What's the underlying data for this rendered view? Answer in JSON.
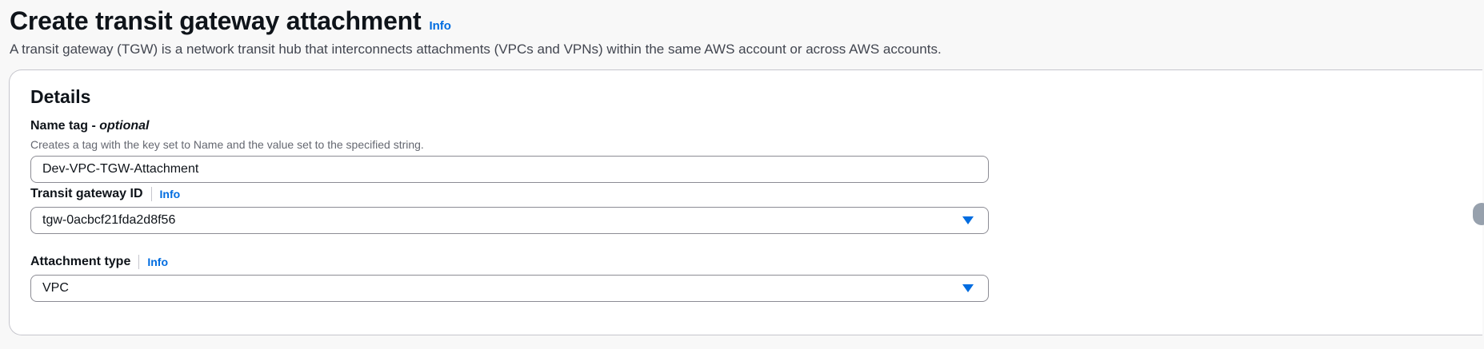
{
  "header": {
    "title": "Create transit gateway attachment",
    "info_label": "Info",
    "description": "A transit gateway (TGW) is a network transit hub that interconnects attachments (VPCs and VPNs) within the same AWS account or across AWS accounts."
  },
  "details": {
    "title": "Details",
    "name_tag": {
      "label": "Name tag - ",
      "label_optional": "optional",
      "hint": "Creates a tag with the key set to Name and the value set to the specified string.",
      "value": "Dev-VPC-TGW-Attachment"
    },
    "transit_gateway_id": {
      "label": "Transit gateway ID",
      "info_label": "Info",
      "selected": "tgw-0acbcf21fda2d8f56"
    },
    "attachment_type": {
      "label": "Attachment type",
      "info_label": "Info",
      "selected": "VPC"
    }
  },
  "colors": {
    "link": "#006ce0",
    "text": "#0f141a",
    "border": "#8c8c94"
  },
  "icons": {
    "dropdown": "caret-down-icon"
  }
}
